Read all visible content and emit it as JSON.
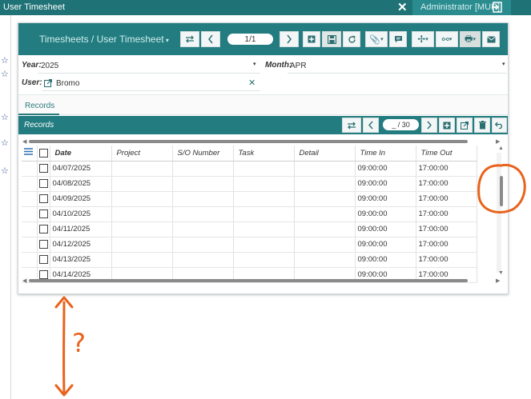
{
  "window": {
    "title": "User Timesheet",
    "user_badge": "Administrator [MUR]"
  },
  "header": {
    "breadcrumb": "Timesheets / User Timesheet",
    "pager": "1/1"
  },
  "form": {
    "year_label": "Year:",
    "year_value": "2025",
    "month_label": "Month:",
    "month_value": "APR",
    "user_label": "User:",
    "user_value": "Bromo"
  },
  "tabs": [
    {
      "label": "Records"
    }
  ],
  "records": {
    "title": "Records",
    "pager": "_ / 30",
    "columns": [
      "Date",
      "Project",
      "S/O Number",
      "Task",
      "Detail",
      "Time In",
      "Time Out"
    ],
    "rows": [
      {
        "date": "04/07/2025",
        "time_in": "09:00:00",
        "time_out": "17:00:00"
      },
      {
        "date": "04/08/2025",
        "time_in": "09:00:00",
        "time_out": "17:00:00"
      },
      {
        "date": "04/09/2025",
        "time_in": "09:00:00",
        "time_out": "17:00:00"
      },
      {
        "date": "04/10/2025",
        "time_in": "09:00:00",
        "time_out": "17:00:00"
      },
      {
        "date": "04/11/2025",
        "time_in": "09:00:00",
        "time_out": "17:00:00"
      },
      {
        "date": "04/12/2025",
        "time_in": "09:00:00",
        "time_out": "17:00:00"
      },
      {
        "date": "04/13/2025",
        "time_in": "09:00:00",
        "time_out": "17:00:00"
      },
      {
        "date": "04/14/2025",
        "time_in": "09:00:00",
        "time_out": "17:00:00"
      }
    ]
  },
  "annotation": {
    "question_mark": "?",
    "color": "#e8631c"
  },
  "colors": {
    "header": "#227c80",
    "topbar": "#1f7275",
    "accent": "#2a7a7d"
  }
}
